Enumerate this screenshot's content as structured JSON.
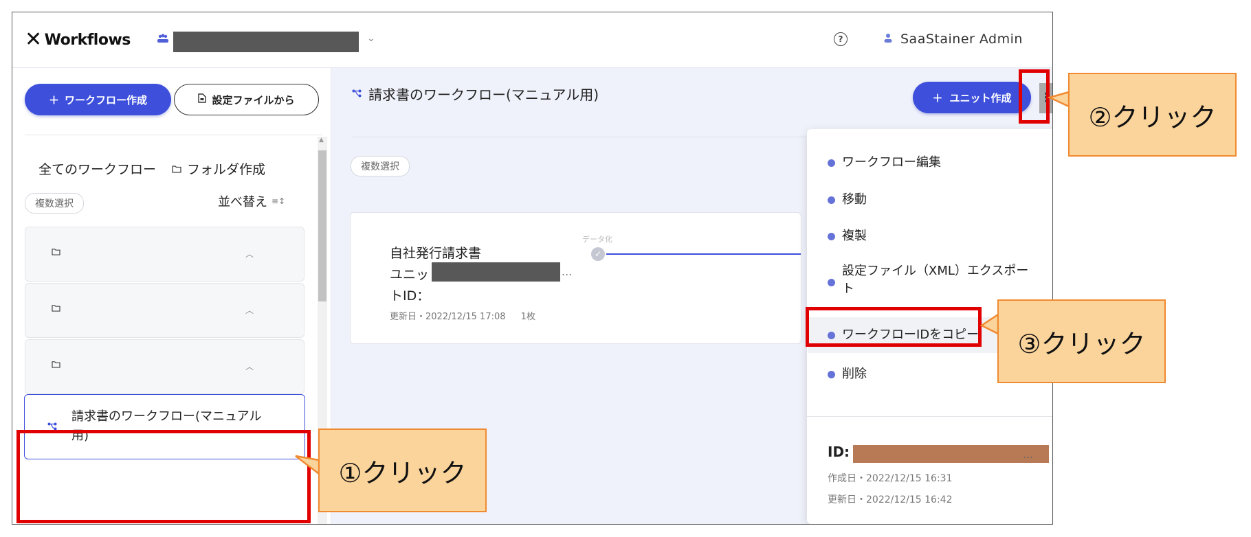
{
  "header": {
    "app_name": "Workflows",
    "user_name": "SaaStainer Admin",
    "icons": {
      "logo": "x-logo-icon",
      "team": "team-icon",
      "help": "help-icon",
      "user": "user-icon"
    }
  },
  "sidebar": {
    "create_button": "ワークフロー作成",
    "from_file_button": "設定ファイルから",
    "all_workflows": "全てのワークフロー",
    "folder_create": "フォルダ作成",
    "multi_select": "複数選択",
    "sort_label": "並べ替え",
    "selected_workflow": "請求書のワークフロー(マニュアル用)"
  },
  "main": {
    "title": "請求書のワークフロー(マニュアル用)",
    "unit_create_button": "ユニット作成",
    "multi_select": "複数選択",
    "unit_card": {
      "name": "自社発行請求書",
      "unit_id_prefix": "ユニッ",
      "unit_id_suffix": "トID：",
      "ellipsis": "...",
      "updated": "更新日・2022/12/15 17:08",
      "count": "1枚",
      "step_label": "データ化"
    }
  },
  "dropdown": {
    "items": [
      {
        "label": "ワークフロー編集"
      },
      {
        "label": "移動"
      },
      {
        "label": "複製"
      },
      {
        "label": "設定ファイル（XML）エクスポート"
      },
      {
        "label": "ワークフローIDをコピー"
      },
      {
        "label": "削除"
      }
    ],
    "id_label": "ID:",
    "ellipsis": "...",
    "created": "作成日・2022/12/15 16:31",
    "updated": "更新日・2022/12/15 16:42"
  },
  "annotations": {
    "step1": "①クリック",
    "step2": "②クリック",
    "step3": "③クリック"
  },
  "colors": {
    "accent": "#3d4fdb",
    "highlight_box": "#e00000",
    "callout_fill": "#fbd49c",
    "callout_border": "#f08a30",
    "redaction": "#585858",
    "id_redaction": "#b87a55"
  }
}
